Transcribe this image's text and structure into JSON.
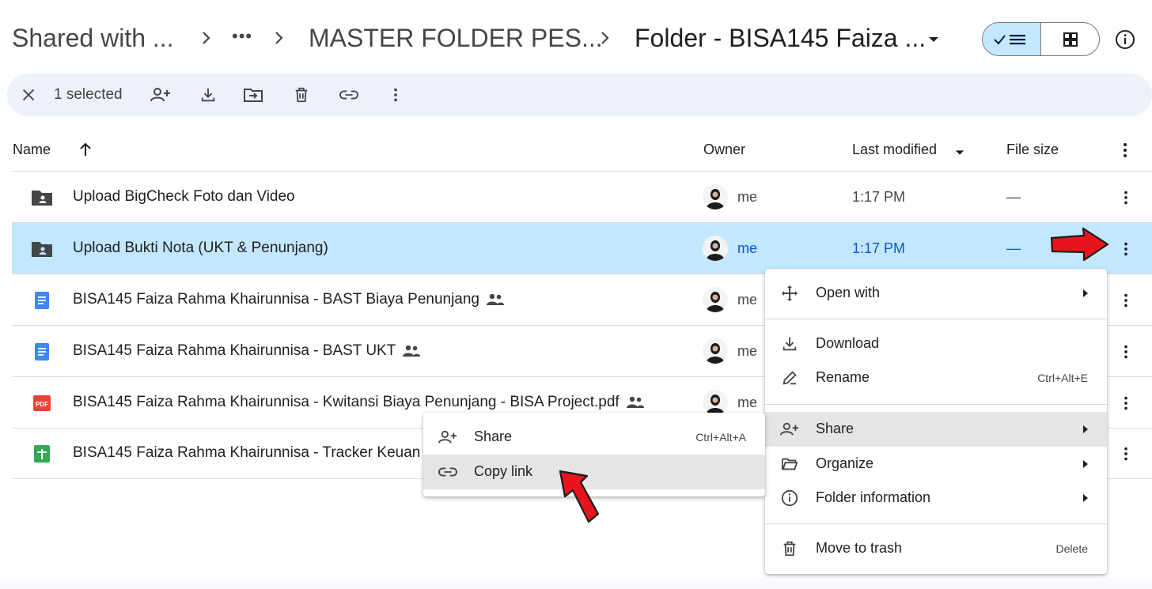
{
  "breadcrumb": {
    "items": [
      "Shared with ...",
      "MASTER FOLDER PES...",
      "Folder - BISA145 Faiza ..."
    ],
    "overflow_label": "•••"
  },
  "toolbar": {
    "selected_label": "1 selected"
  },
  "table": {
    "headers": {
      "name": "Name",
      "owner": "Owner",
      "modified": "Last modified",
      "size": "File size"
    },
    "rows": [
      {
        "name": "Upload BigCheck Foto dan Video",
        "type": "folder",
        "shared": false,
        "owner": "me",
        "modified": "1:17 PM",
        "size": "—"
      },
      {
        "name": "Upload Bukti Nota (UKT & Penunjang)",
        "type": "folder",
        "shared": false,
        "owner": "me",
        "modified": "1:17 PM",
        "size": "—"
      },
      {
        "name": "BISA145 Faiza Rahma Khairunnisa - BAST Biaya Penunjang",
        "type": "doc",
        "shared": true,
        "owner": "me"
      },
      {
        "name": "BISA145 Faiza Rahma Khairunnisa - BAST UKT",
        "type": "doc",
        "shared": true,
        "owner": "me"
      },
      {
        "name": "BISA145 Faiza Rahma Khairunnisa - Kwitansi Biaya Penunjang - BISA Project.pdf",
        "type": "pdf",
        "shared": true,
        "owner": "me"
      },
      {
        "name": "BISA145 Faiza Rahma Khairunnisa - Tracker Keuan",
        "type": "sheet",
        "shared": false,
        "owner": ""
      }
    ],
    "pdf_badge": "PDF"
  },
  "context_menu": {
    "items": [
      {
        "label": "Open with",
        "shortcut": ""
      },
      {
        "label": "Download",
        "shortcut": ""
      },
      {
        "label": "Rename",
        "shortcut": "Ctrl+Alt+E"
      },
      {
        "label": "Share",
        "shortcut": ""
      },
      {
        "label": "Organize",
        "shortcut": ""
      },
      {
        "label": "Folder information",
        "shortcut": ""
      },
      {
        "label": "Move to trash",
        "shortcut": "Delete"
      }
    ]
  },
  "share_submenu": {
    "items": [
      {
        "label": "Share",
        "shortcut": "Ctrl+Alt+A"
      },
      {
        "label": "Copy link",
        "shortcut": ""
      }
    ]
  },
  "colors": {
    "selected_row": "#c2e7ff",
    "toolbar_bg": "#edf1f9",
    "menu_highlight": "#e5e5e5",
    "annotation_arrow": "#e8141c",
    "doc_blue": "#4285f4",
    "pdf_red": "#ea4335",
    "sheet_green": "#34a853"
  }
}
